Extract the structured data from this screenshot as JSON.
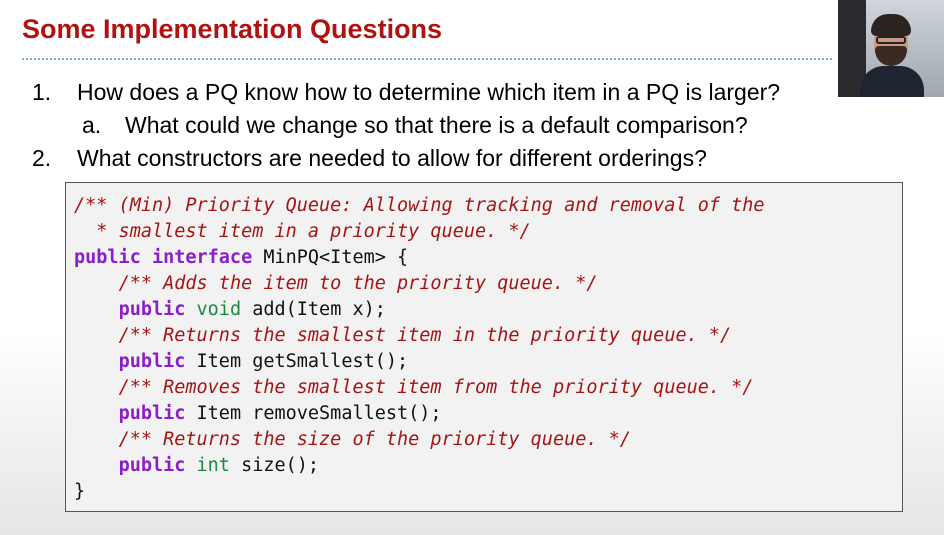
{
  "slide": {
    "title": "Some Implementation Questions",
    "colors": {
      "title": "#b01212",
      "rule": "#7fb2c4",
      "comment": "#a31515",
      "keyword": "#8a1fc7",
      "primitive": "#1a8a3a"
    }
  },
  "questions": [
    {
      "number": "1.",
      "text": "How does a PQ know how to determine which item in a PQ is larger?"
    },
    {
      "number": "a.",
      "text": "What could we change so that there is a default comparison?"
    },
    {
      "number": "2.",
      "text": "What constructors are needed to allow for different orderings?"
    }
  ],
  "code": {
    "lines": [
      {
        "c1": "/** (Min) Priority Queue: Allowing tracking and removal of the"
      },
      {
        "c1": "  * smallest item in a priority queue. */"
      },
      {
        "k1": "public",
        "k2": "interface",
        "rest": " MinPQ<Item> {"
      },
      {
        "indent": "    ",
        "c1": "/** Adds the item to the priority queue. */"
      },
      {
        "indent": "    ",
        "k1": "public",
        "t1": "void",
        "rest": " add(Item x);"
      },
      {
        "indent": "    ",
        "c1": "/** Returns the smallest item in the priority queue. */"
      },
      {
        "indent": "    ",
        "k1": "public",
        "rest": " Item getSmallest();"
      },
      {
        "indent": "    ",
        "c1": "/** Removes the smallest item from the priority queue. */"
      },
      {
        "indent": "    ",
        "k1": "public",
        "rest": " Item removeSmallest();"
      },
      {
        "indent": "    ",
        "c1": "/** Returns the size of the priority queue. */"
      },
      {
        "indent": "    ",
        "k1": "public",
        "t1": "int",
        "rest": " size();"
      },
      {
        "rest": "}"
      }
    ]
  },
  "webcam": {
    "icon": "presenter-video-icon"
  }
}
